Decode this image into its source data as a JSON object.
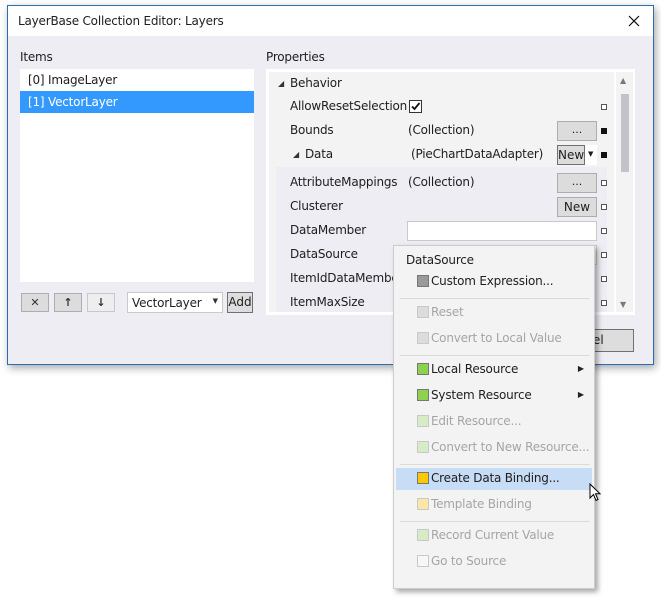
{
  "window": {
    "title": "LayerBase Collection Editor: Layers",
    "close_icon": "close-x-icon"
  },
  "items_panel": {
    "label": "Items",
    "items": [
      {
        "label": "[0] ImageLayer",
        "selected": false
      },
      {
        "label": "[1] VectorLayer",
        "selected": true
      }
    ],
    "toolbar": {
      "remove_icon": "✕",
      "move_up_icon": "↑",
      "move_down_icon": "↓",
      "type_combo_value": "VectorLayer",
      "add_label": "Add"
    }
  },
  "properties_panel": {
    "label": "Properties",
    "category": "Behavior",
    "rows": [
      {
        "name": "AllowResetSelection",
        "value": "",
        "checked": true
      },
      {
        "name": "Bounds",
        "value": "(Collection)",
        "button": "..."
      },
      {
        "name": "Data",
        "value": "(PieChartDataAdapter)",
        "button": "New"
      },
      {
        "name": "AttributeMappings",
        "value": "(Collection)",
        "button": "..."
      },
      {
        "name": "Clusterer",
        "value": "",
        "button": "New"
      },
      {
        "name": "DataMember",
        "value": ""
      },
      {
        "name": "DataSource",
        "value": ""
      },
      {
        "name": "ItemIdDataMember",
        "value": ""
      },
      {
        "name": "ItemMaxSize",
        "value": ""
      }
    ]
  },
  "dialog_buttons": {
    "cancel_label": "Cancel",
    "cancel_visible_text": "ncel"
  },
  "context_menu": {
    "header": "DataSource",
    "items": [
      {
        "label": "Custom Expression...",
        "color": "#9a9a9a",
        "enabled": true
      },
      {
        "label": "Reset",
        "color": "#dcdcdc",
        "enabled": false
      },
      {
        "label": "Convert to Local Value",
        "color": "#dcdcdc",
        "enabled": false
      },
      {
        "label": "Local Resource",
        "color": "#8cd24e",
        "enabled": true,
        "submenu": true
      },
      {
        "label": "System Resource",
        "color": "#8cd24e",
        "enabled": true,
        "submenu": true
      },
      {
        "label": "Edit Resource...",
        "color": "#d6ecc6",
        "enabled": false
      },
      {
        "label": "Convert to New Resource...",
        "color": "#d6ecc6",
        "enabled": false
      },
      {
        "label": "Create Data Binding...",
        "color": "#ffc800",
        "enabled": true,
        "highlighted": true
      },
      {
        "label": "Template Binding",
        "color": "#fbe7a6",
        "enabled": false
      },
      {
        "label": "Record Current Value",
        "color": "#d6ecc6",
        "enabled": false
      },
      {
        "label": "Go to Source",
        "color": "#f7f7f7",
        "enabled": false
      }
    ]
  },
  "colors": {
    "selection": "#3399ff",
    "menu_highlight": "#c7dcf5",
    "window_border": "#2b6db5"
  }
}
